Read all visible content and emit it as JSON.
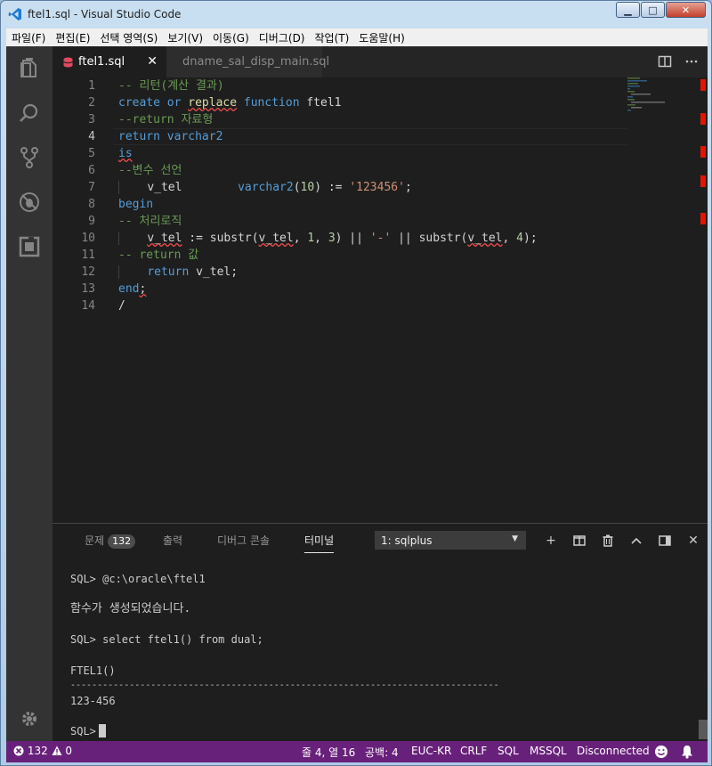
{
  "window": {
    "title": "ftel1.sql - Visual Studio Code",
    "btn_min": "▁",
    "btn_max": "□",
    "btn_close": "✕"
  },
  "menu": [
    "파일(F)",
    "편집(E)",
    "선택 영역(S)",
    "보기(V)",
    "이동(G)",
    "디버그(D)",
    "작업(T)",
    "도움말(H)"
  ],
  "tabs": [
    {
      "label": "ftel1.sql",
      "active": true,
      "close": "✕"
    },
    {
      "label": "dname_sal_disp_main.sql",
      "active": false
    }
  ],
  "editor": {
    "current_line": 4,
    "line_numbers": [
      "1",
      "2",
      "3",
      "4",
      "5",
      "6",
      "7",
      "8",
      "9",
      "10",
      "11",
      "12",
      "13",
      "14"
    ],
    "lines": [
      [
        "-- 리턴(계산 결과)"
      ],
      [
        "create",
        " ",
        "or",
        " ",
        "replace",
        " ",
        "function",
        " ftel1"
      ],
      [
        "--return 자료형"
      ],
      [
        "return",
        " ",
        "varchar2"
      ],
      [
        "is"
      ],
      [
        "--변수 선언"
      ],
      [
        "    ",
        "v_tel",
        "        ",
        "varchar2",
        "(",
        "10",
        ") := ",
        "'123456'",
        ";"
      ],
      [
        "begin"
      ],
      [
        "-- 처리로직"
      ],
      [
        "    ",
        "v_tel",
        " := substr(",
        "v_tel",
        ", ",
        "1",
        ", ",
        "3",
        ") || ",
        "'-'",
        " || substr(",
        "v_tel",
        ", ",
        "4",
        ");"
      ],
      [
        "-- return 값"
      ],
      [
        "    ",
        "return",
        " v_tel;"
      ],
      [
        "end",
        ";"
      ],
      [
        "/"
      ]
    ]
  },
  "panel": {
    "tabs": {
      "problems": "문제",
      "problems_count": "132",
      "output": "출력",
      "debug_console": "디버그 콘솔",
      "terminal": "터미널"
    },
    "terminal_select": "1: sqlplus",
    "actions": {
      "add": "+",
      "split": "◫",
      "trash": "🗑",
      "maximize": "⌃",
      "layout": "◨",
      "close": "✕"
    },
    "terminal_lines": [
      "SQL> @c:\\oracle\\ftel1",
      "함수가 생성되었습니다.",
      "SQL> select ftel1() from dual;",
      "FTEL1()",
      "--------------------------------------------------------------------------------",
      "123-456",
      "SQL>"
    ]
  },
  "status": {
    "errors": "132",
    "warnings": "0",
    "position": "줄 4, 열 16",
    "spaces": "공백: 4",
    "encoding": "EUC-KR",
    "eol": "CRLF",
    "language": "SQL",
    "connection_type": "MSSQL",
    "connection_state": "Disconnected"
  },
  "colors": {
    "statusbar": "#68217a",
    "keyword": "#569cd6",
    "comment": "#6a9955",
    "string": "#ce9178",
    "number": "#b5cea8"
  }
}
